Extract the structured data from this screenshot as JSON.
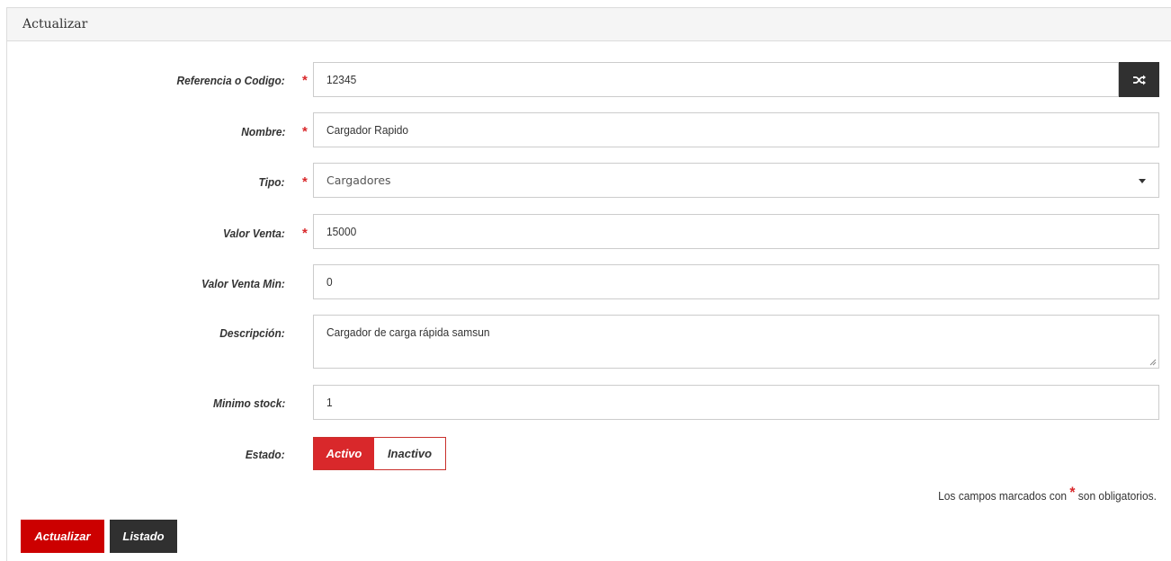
{
  "panel": {
    "title": "Actualizar"
  },
  "form": {
    "reference": {
      "label": "Referencia o Codigo:",
      "value": "12345",
      "required": true
    },
    "name": {
      "label": "Nombre:",
      "value": "Cargador Rapido",
      "required": true
    },
    "type": {
      "label": "Tipo:",
      "selected": "Cargadores",
      "required": true
    },
    "sale_value": {
      "label": "Valor Venta:",
      "value": "15000",
      "required": true
    },
    "min_sale_value": {
      "label": "Valor Venta Min:",
      "value": "0",
      "required": false
    },
    "description": {
      "label": "Descripción:",
      "value": "Cargador de carga rápida samsun",
      "required": false
    },
    "min_stock": {
      "label": "Minimo stock:",
      "value": "1",
      "required": false
    },
    "status": {
      "label": "Estado:",
      "options": [
        "Activo",
        "Inactivo"
      ],
      "selected": "Activo"
    }
  },
  "required_note": {
    "before": "Los campos marcados con",
    "star": "*",
    "after": "son obligatorios."
  },
  "buttons": {
    "update": "Actualizar",
    "list": "Listado"
  },
  "icons": {
    "shuffle": "shuffle-icon",
    "caret": "caret-down-icon"
  },
  "colors": {
    "primary_red": "#cc0000",
    "accent_red": "#d9282b",
    "dark": "#303030",
    "panel_heading": "#f5f5f5",
    "border": "#cccccc"
  }
}
